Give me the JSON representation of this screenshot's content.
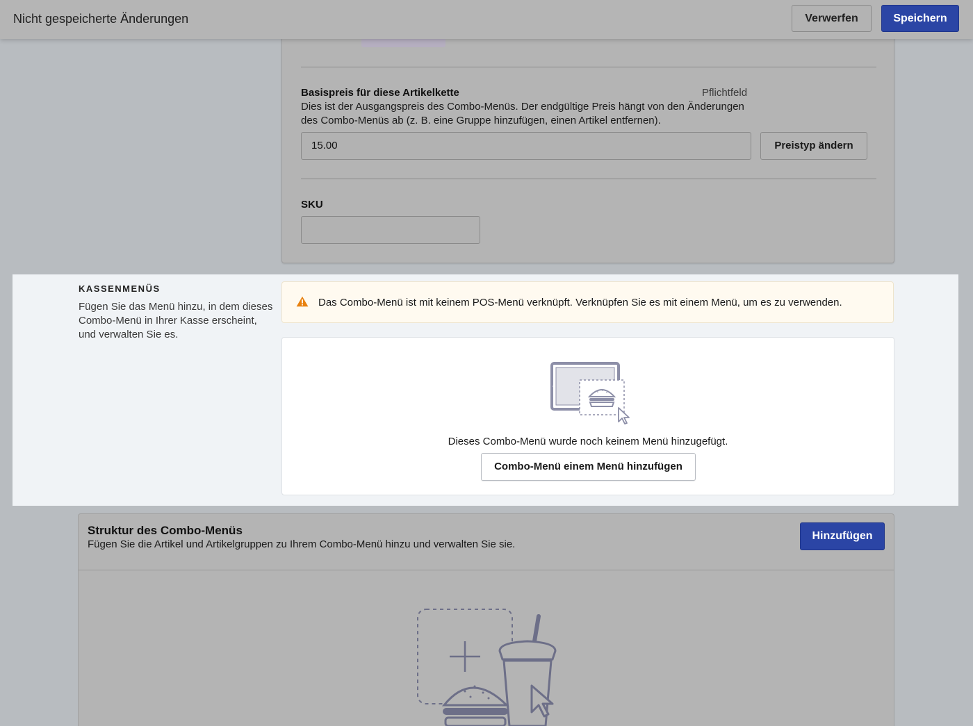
{
  "topbar": {
    "title": "Nicht gespeicherte Änderungen",
    "discard_label": "Verwerfen",
    "save_label": "Speichern"
  },
  "price": {
    "label": "Basispreis für diese Artikelkette",
    "required": "Pflichtfeld",
    "description_line1": "Dies ist der Ausgangspreis des Combo-Menüs. Der endgültige Preis hängt von den Änderungen",
    "description_line2": "des Combo-Menüs ab (z. B. eine Gruppe hinzufügen, einen Artikel entfernen).",
    "value": "15.00",
    "change_type_label": "Preistyp ändern"
  },
  "sku": {
    "label": "SKU",
    "value": ""
  },
  "pos_menus": {
    "heading": "KASSENMENÜS",
    "subtitle": "Fügen Sie das Menü hinzu, in dem dieses Combo-Menü in Ihrer Kasse erscheint, und verwalten Sie es.",
    "warning": "Das Combo-Menü ist mit keinem POS-Menü verknüpft. Verknüpfen Sie es mit einem Menü, um es zu verwenden.",
    "empty_text": "Dieses Combo-Menü wurde noch keinem Menü hinzugefügt.",
    "add_button": "Combo-Menü einem Menü hinzufügen",
    "warning_color": "#e8810f"
  },
  "structure": {
    "title": "Struktur des Combo-Menüs",
    "subtitle": "Fügen Sie die Artikel und Artikelgruppen zu Ihrem Combo-Menü hinzu und verwalten Sie sie.",
    "add_label": "Hinzufügen"
  },
  "colors": {
    "primary": "#2b45a5",
    "illustration": "#8d8fa8"
  }
}
